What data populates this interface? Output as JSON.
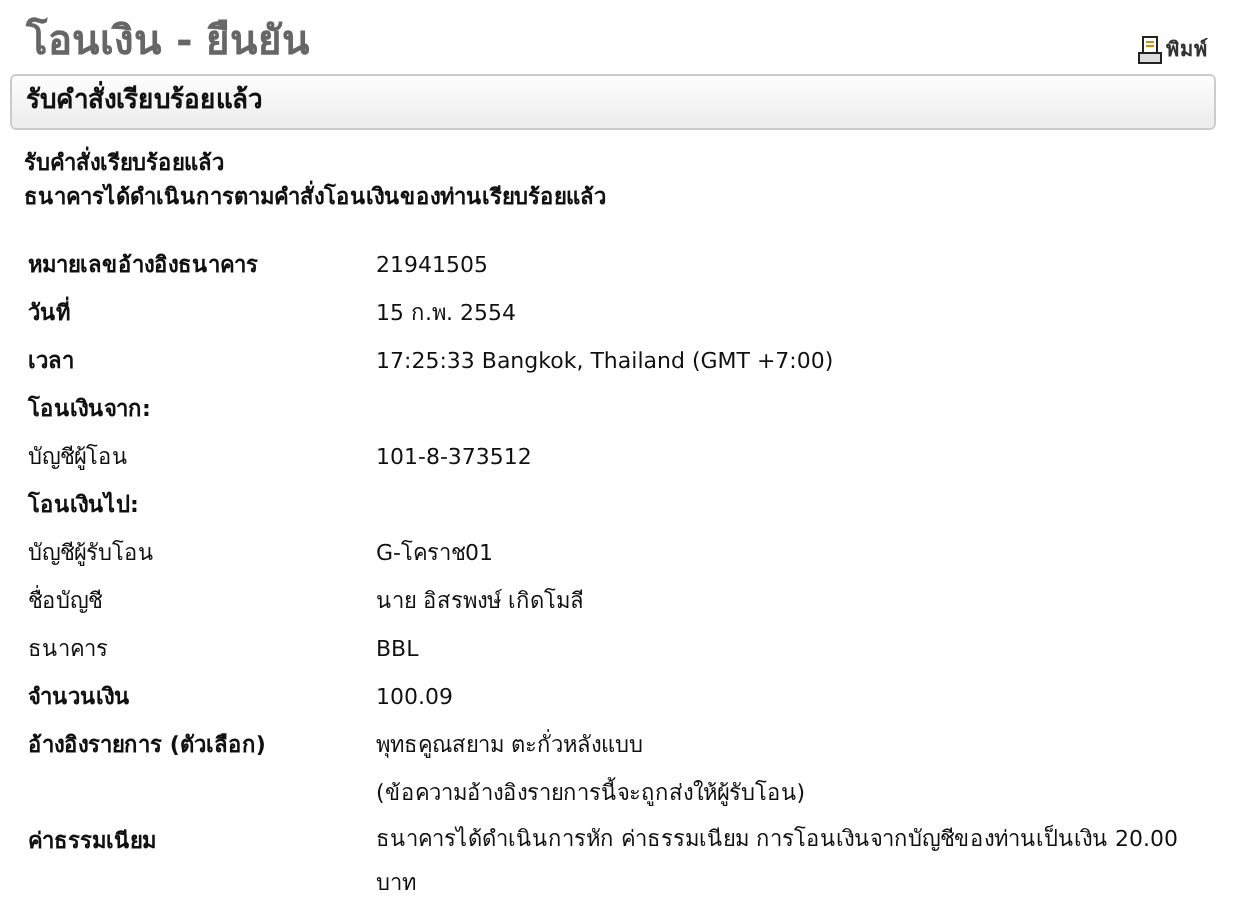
{
  "page_title": "โอนเงิน - ยืนยัน",
  "print_link": "พิมพ์",
  "panel_header": "รับคำสั่งเรียบร้อยแล้ว",
  "messages": [
    "รับคำสั่งเรียบร้อยแล้ว",
    "ธนาคารได้ดำเนินการตามคำสั่งโอนเงินของท่านเรียบร้อยแล้ว"
  ],
  "rows": [
    {
      "kind": "field",
      "label": "หมายเลขอ้างอิงธนาคาร",
      "label_bold": true,
      "value_lines": [
        "21941505"
      ]
    },
    {
      "kind": "field",
      "label": "วันที่",
      "label_bold": true,
      "value_lines": [
        "15 ก.พ. 2554"
      ]
    },
    {
      "kind": "field",
      "label": "เวลา",
      "label_bold": true,
      "value_lines": [
        "17:25:33 Bangkok, Thailand (GMT +7:00)"
      ]
    },
    {
      "kind": "section",
      "label": "โอนเงินจาก:",
      "label_bold": true
    },
    {
      "kind": "field",
      "label": "บัญชีผู้โอน",
      "label_bold": false,
      "value_lines": [
        "101-8-373512"
      ]
    },
    {
      "kind": "section",
      "label": "โอนเงินไป:",
      "label_bold": true
    },
    {
      "kind": "field",
      "label": "บัญชีผู้รับโอน",
      "label_bold": false,
      "value_lines": [
        "G-โคราช01"
      ]
    },
    {
      "kind": "field",
      "label": "ชื่อบัญชี",
      "label_bold": false,
      "value_lines": [
        "นาย อิสรพงษ์ เกิดโมลี"
      ]
    },
    {
      "kind": "field",
      "label": "ธนาคาร",
      "label_bold": false,
      "value_lines": [
        "BBL"
      ]
    },
    {
      "kind": "field",
      "label": "จำนวนเงิน",
      "label_bold": true,
      "value_lines": [
        "100.09"
      ]
    },
    {
      "kind": "field",
      "label": "อ้างอิงรายการ (ตัวเลือก)",
      "label_bold": true,
      "value_lines": [
        "พุทธคูณสยาม ตะกั่วหลังแบบ",
        "(ข้อความอ้างอิงรายการนี้จะถูกส่งให้ผู้รับโอน)"
      ]
    },
    {
      "kind": "field",
      "label": "ค่าธรรมเนียม",
      "label_bold": true,
      "value_lines": [
        "ธนาคารได้ดำเนินการหัก ค่าธรรมเนียม การโอนเงินจากบัญชีของท่านเป็นเงิน 20.00",
        "บาท"
      ]
    }
  ]
}
